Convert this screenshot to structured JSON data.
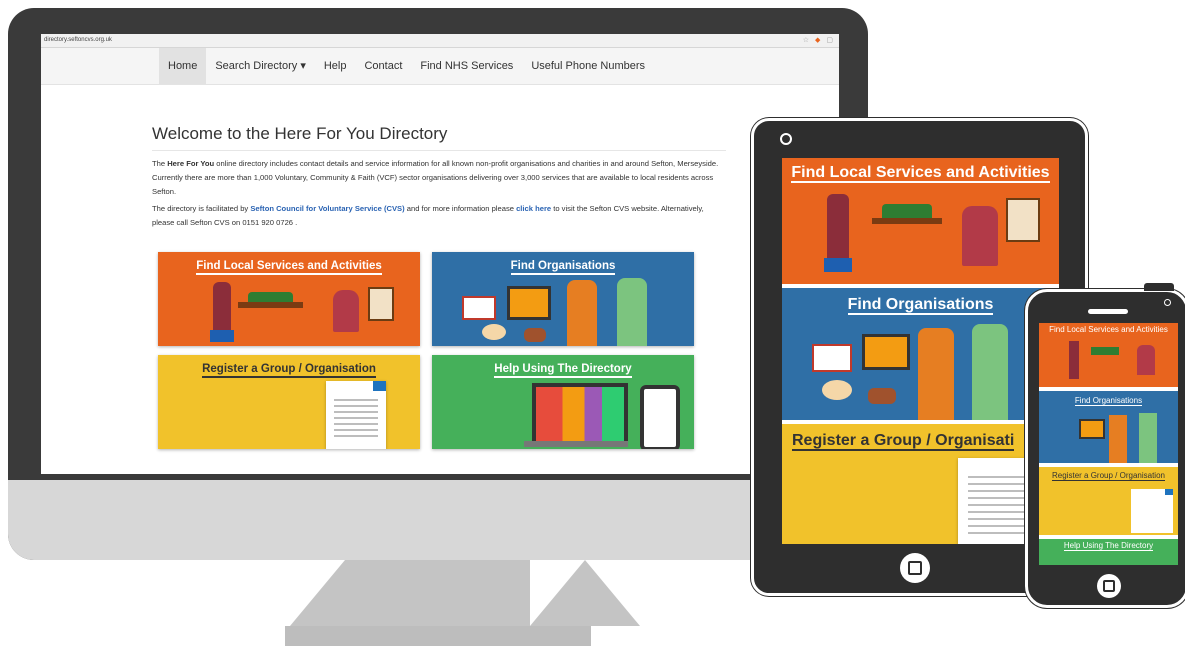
{
  "browser": {
    "url": "directory.seftoncvs.org.uk"
  },
  "nav": {
    "items": [
      "Home",
      "Search Directory ▾",
      "Help",
      "Contact",
      "Find NHS Services",
      "Useful Phone Numbers"
    ]
  },
  "main": {
    "heading": "Welcome to the Here For You Directory",
    "p1_pre": "The ",
    "p1_bold": "Here For You",
    "p1_rest": " online directory includes contact details and service information for all known non-profit organisations and charities in and around Sefton, Merseyside. Currently there are more than 1,000 Voluntary, Community & Faith (VCF) sector organisations delivering over 3,000 services that are available to local residents across Sefton.",
    "p2_pre": "The directory is facilitated by ",
    "p2_link1": "Sefton Council for Voluntary Service (CVS)",
    "p2_mid": " and for more information please ",
    "p2_link2": "click here",
    "p2_rest": " to visit the Sefton CVS website. Alternatively, please call Sefton CVS on 0151 920 0726 ."
  },
  "tiles": {
    "find_local": "Find Local Services and Activities",
    "find_orgs": "Find Organisations",
    "register": "Register a Group / Organisation",
    "help": "Help Using The Directory"
  },
  "tablet": {
    "find_local": "Find Local Services and Activities",
    "find_orgs": "Find Organisations",
    "register": "Register a Group / Organisati"
  },
  "phone": {
    "find_local": "Find Local Services and Activities",
    "find_orgs": "Find Organisations",
    "register": "Register a Group / Organisation",
    "help": "Help Using The Directory"
  },
  "colors": {
    "orange": "#e8641e",
    "blue": "#2f6fa6",
    "yellow": "#f1c22b",
    "green": "#45b05a",
    "link": "#2a63b3"
  }
}
